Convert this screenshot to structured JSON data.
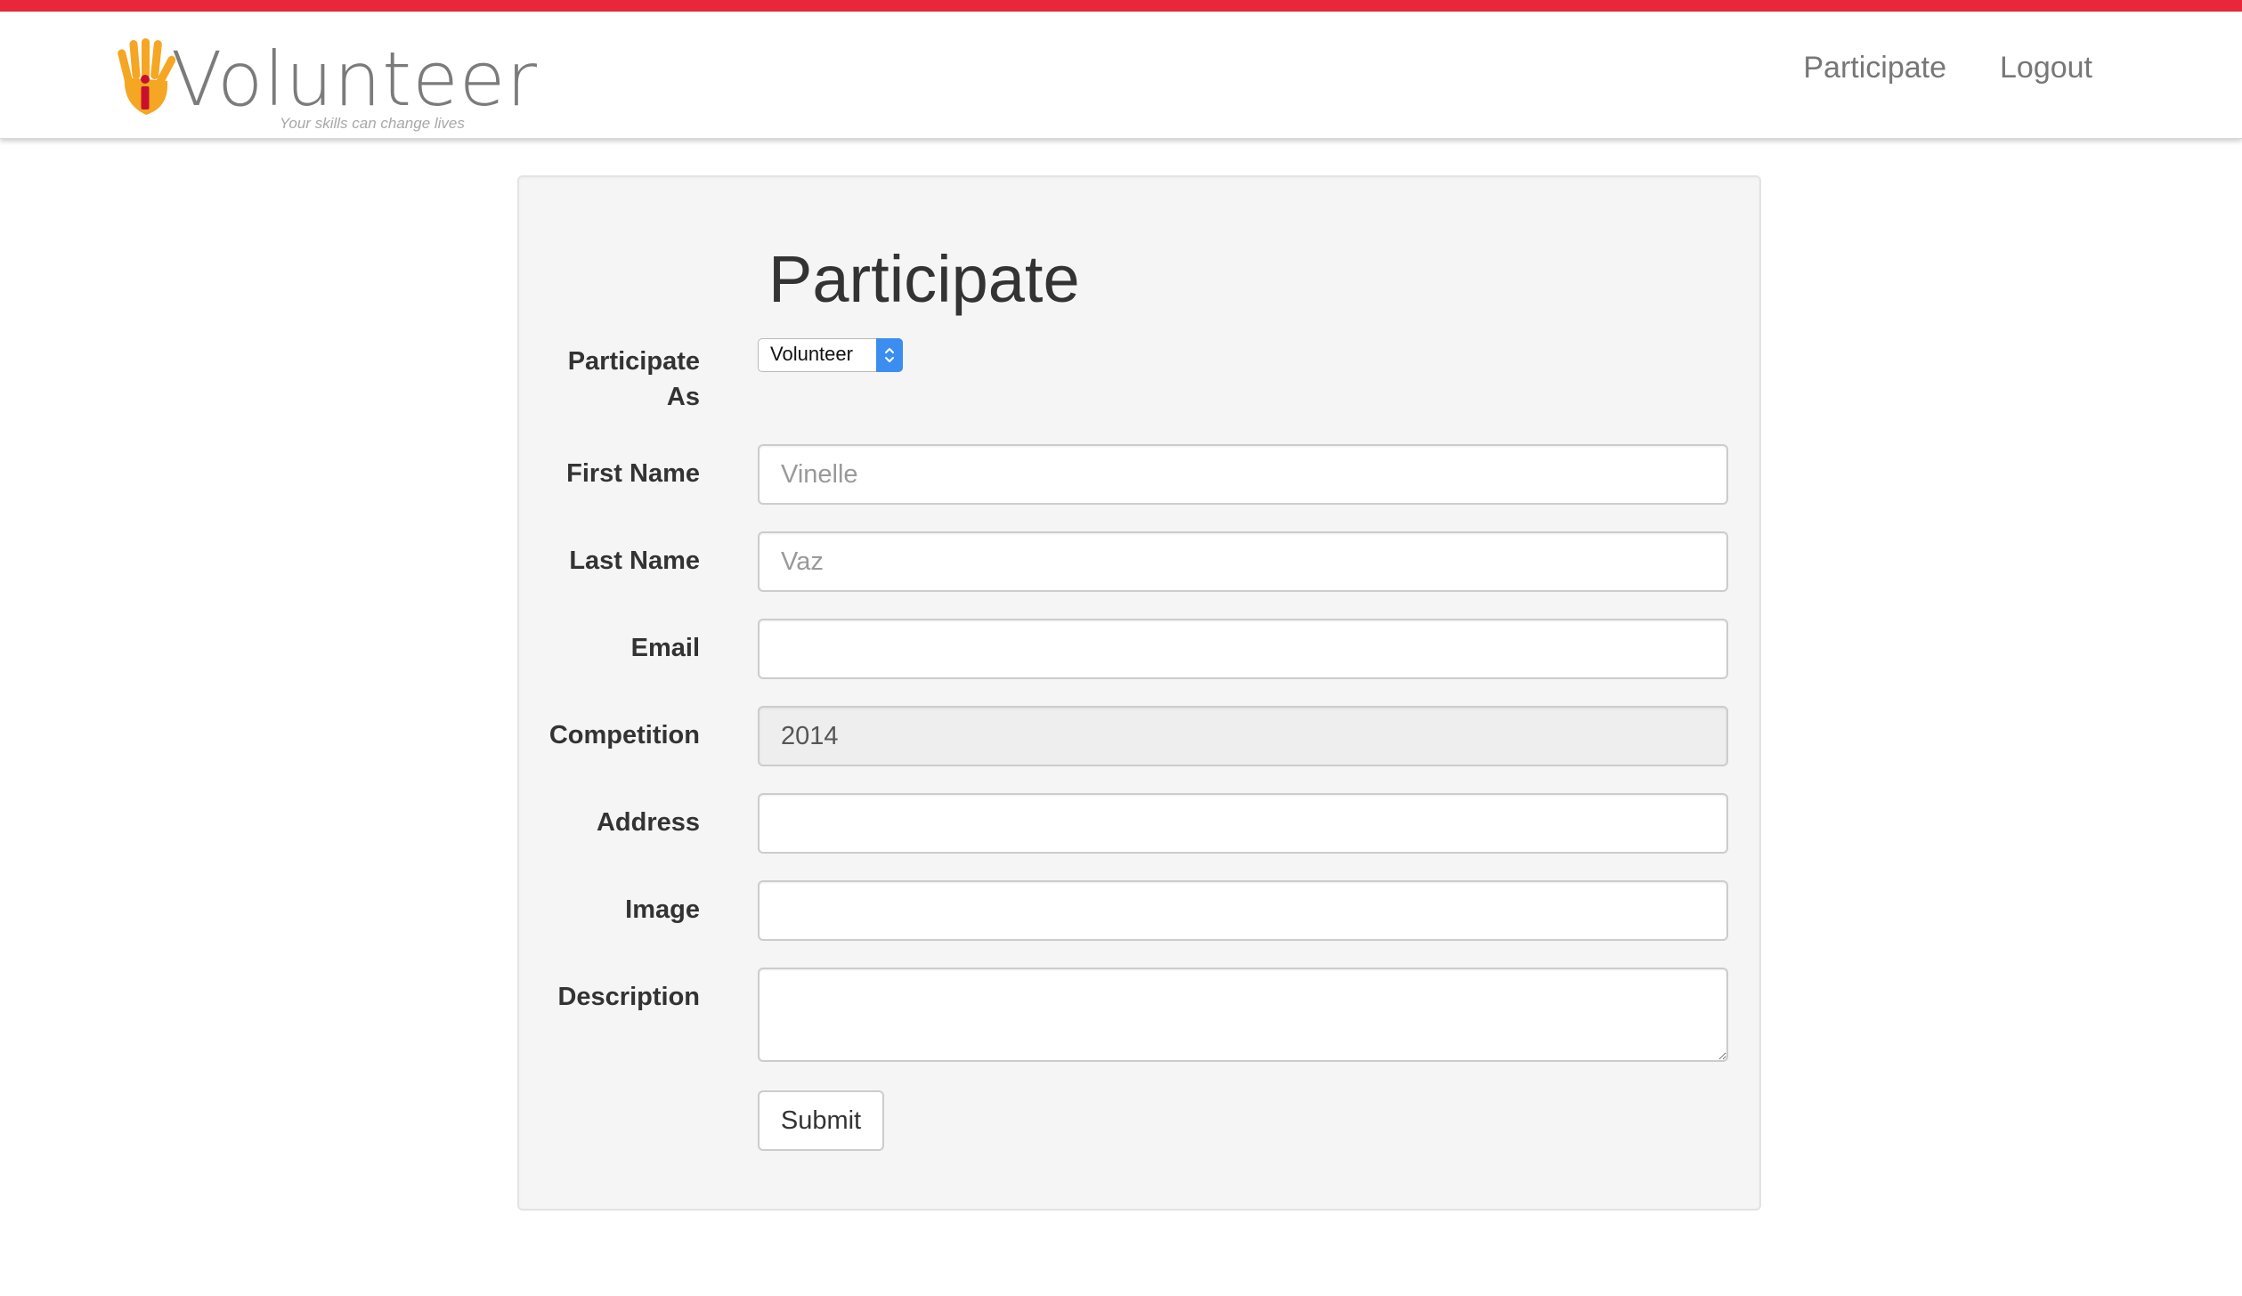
{
  "theme": {
    "accent_red": "#e8283a",
    "logo_orange": "#f5a623",
    "logo_red": "#c8102e",
    "select_blue": "#3b8ef0"
  },
  "header": {
    "logo": {
      "wordmark": "Volunteer",
      "tagline": "Your skills can change lives",
      "icon": "hand-icon"
    },
    "nav": [
      {
        "label": "Participate"
      },
      {
        "label": "Logout"
      }
    ]
  },
  "form": {
    "title": "Participate",
    "participate_as": {
      "label_line1": "Participate",
      "label_line2": "As",
      "selected": "Volunteer"
    },
    "first_name": {
      "label": "First Name",
      "placeholder": "Vinelle",
      "value": ""
    },
    "last_name": {
      "label": "Last Name",
      "placeholder": "Vaz",
      "value": ""
    },
    "email": {
      "label": "Email",
      "value": ""
    },
    "competition": {
      "label": "Competition",
      "value": "2014"
    },
    "address": {
      "label": "Address",
      "value": ""
    },
    "image": {
      "label": "Image",
      "value": ""
    },
    "description": {
      "label": "Description",
      "value": ""
    },
    "submit_label": "Submit"
  }
}
